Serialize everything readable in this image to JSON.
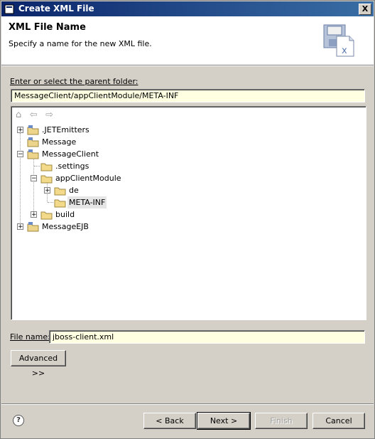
{
  "window": {
    "title": "Create XML File",
    "close_glyph": "X"
  },
  "banner": {
    "title": "XML File Name",
    "description": "Specify a name for the new XML file."
  },
  "parent": {
    "label": "Enter or select the parent folder:",
    "value": "MessageClient/appClientModule/META-INF"
  },
  "tree": {
    "toolbar": {
      "home_glyph": "⌂",
      "back_glyph": "⇦",
      "forward_glyph": "⇨"
    },
    "items": [
      {
        "label": ".JETEmitters",
        "expander": "+",
        "selected": false
      },
      {
        "label": "Message",
        "expander": "",
        "selected": false
      },
      {
        "label": "MessageClient",
        "expander": "−",
        "selected": false
      },
      {
        "label": ".settings",
        "expander": "",
        "selected": false
      },
      {
        "label": "appClientModule",
        "expander": "−",
        "selected": false
      },
      {
        "label": "de",
        "expander": "+",
        "selected": false
      },
      {
        "label": "META-INF",
        "expander": "",
        "selected": true
      },
      {
        "label": "build",
        "expander": "+",
        "selected": false
      },
      {
        "label": "MessageEJB",
        "expander": "+",
        "selected": false
      }
    ]
  },
  "file": {
    "label": "File name:",
    "value": "jboss-client.xml"
  },
  "buttons": {
    "advanced": "Advanced >>",
    "back": "< Back",
    "next": "Next >",
    "finish": "Finish",
    "cancel": "Cancel",
    "help": "?"
  },
  "colors": {
    "title_start": "#0a246a",
    "title_end": "#3a6ea5",
    "input_bg": "#ffffe1",
    "dialog_bg": "#d4d0c8"
  }
}
